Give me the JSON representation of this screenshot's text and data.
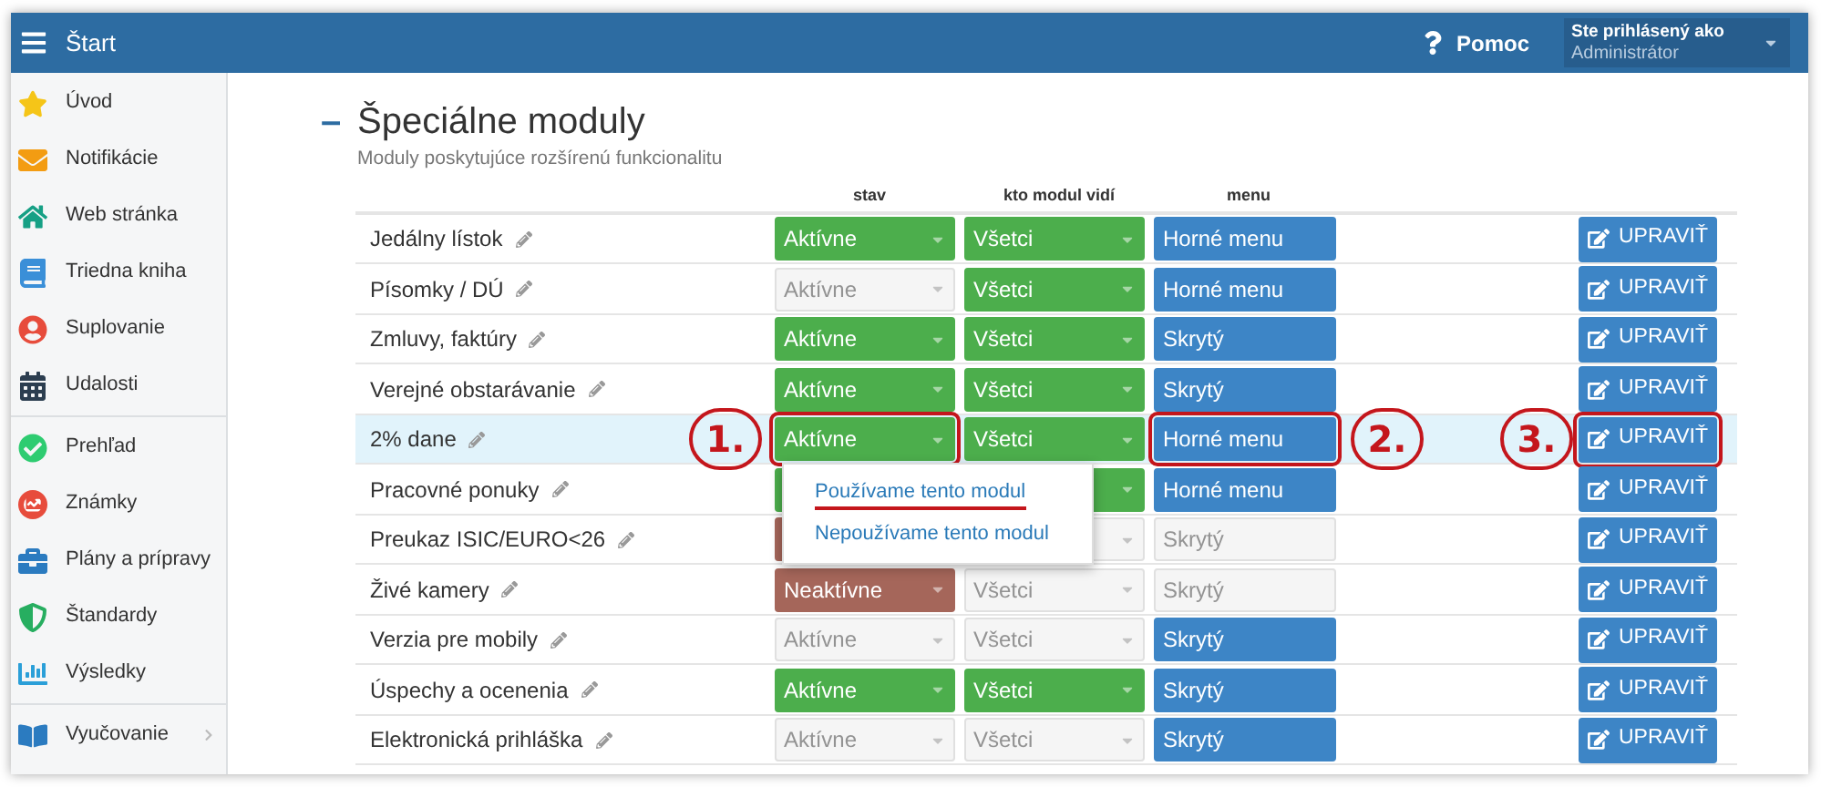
{
  "header": {
    "title": "Štart",
    "help": "Pomoc",
    "user": {
      "label": "Ste prihlásený ako",
      "name": "Administrátor"
    }
  },
  "sidebar": {
    "groups": [
      [
        {
          "label": "Úvod",
          "has_submenu": false
        },
        {
          "label": "Notifikácie",
          "has_submenu": false
        },
        {
          "label": "Web stránka",
          "has_submenu": false
        },
        {
          "label": "Triedna kniha",
          "has_submenu": false
        },
        {
          "label": "Suplovanie",
          "has_submenu": false
        },
        {
          "label": "Udalosti",
          "has_submenu": false
        }
      ],
      [
        {
          "label": "Prehľad",
          "has_submenu": false
        },
        {
          "label": "Známky",
          "has_submenu": false
        },
        {
          "label": "Plány a prípravy",
          "has_submenu": false
        },
        {
          "label": "Štandardy",
          "has_submenu": false
        },
        {
          "label": "Výsledky",
          "has_submenu": false
        }
      ],
      [
        {
          "label": "Vyučovanie",
          "has_submenu": true
        }
      ]
    ]
  },
  "section": {
    "collapse": "–",
    "title": "Špeciálne moduly",
    "subtitle": "Moduly poskytujúce rozšírenú funkcionalitu"
  },
  "table": {
    "columns": [
      "stav",
      "kto modul vidí",
      "menu"
    ],
    "rows": [
      {
        "name": "Jedálny lístok",
        "selected": false,
        "status": {
          "text": "Aktívne",
          "kind": "active"
        },
        "visibility": {
          "text": "Všetci",
          "disabled": false
        },
        "menu": {
          "text": "Horné menu",
          "disabled": false
        },
        "edit": "UPRAVIŤ"
      },
      {
        "name": "Písomky / DÚ",
        "selected": false,
        "status": {
          "text": "Aktívne",
          "kind": "disabled"
        },
        "visibility": {
          "text": "Všetci",
          "disabled": false
        },
        "menu": {
          "text": "Horné menu",
          "disabled": false
        },
        "edit": "UPRAVIŤ"
      },
      {
        "name": "Zmluvy, faktúry",
        "selected": false,
        "status": {
          "text": "Aktívne",
          "kind": "active"
        },
        "visibility": {
          "text": "Všetci",
          "disabled": false
        },
        "menu": {
          "text": "Skrytý",
          "disabled": false
        },
        "edit": "UPRAVIŤ"
      },
      {
        "name": "Verejné obstarávanie",
        "selected": false,
        "status": {
          "text": "Aktívne",
          "kind": "active"
        },
        "visibility": {
          "text": "Všetci",
          "disabled": false
        },
        "menu": {
          "text": "Skrytý",
          "disabled": false
        },
        "edit": "UPRAVIŤ"
      },
      {
        "name": "2% dane",
        "selected": true,
        "status": {
          "text": "Aktívne",
          "kind": "active"
        },
        "visibility": {
          "text": "Všetci",
          "disabled": false
        },
        "menu": {
          "text": "Horné menu",
          "disabled": false
        },
        "edit": "UPRAVIŤ",
        "callouts": {
          "status": "1.",
          "menu": "2.",
          "edit": "3."
        },
        "dropdown": [
          {
            "label": "Používame tento modul",
            "marked": true
          },
          {
            "label": "Nepoužívame tento modul",
            "marked": false
          }
        ]
      },
      {
        "name": "Pracovné ponuky",
        "selected": false,
        "status": {
          "kind": "active"
        },
        "visibility": {
          "disabled": false
        },
        "menu": {
          "text": "Horné menu",
          "disabled": false
        },
        "edit": "UPRAVIŤ"
      },
      {
        "name": "Preukaz ISIC/EURO<26",
        "selected": false,
        "status": {
          "kind": "inactive"
        },
        "visibility": {
          "disabled": true
        },
        "menu": {
          "text": "Skrytý",
          "disabled": true
        },
        "edit": "UPRAVIŤ"
      },
      {
        "name": "Živé kamery",
        "selected": false,
        "status": {
          "text": "Neaktívne",
          "kind": "inactive"
        },
        "visibility": {
          "text": "Všetci",
          "disabled": true
        },
        "menu": {
          "text": "Skrytý",
          "disabled": true
        },
        "edit": "UPRAVIŤ"
      },
      {
        "name": "Verzia pre mobily",
        "selected": false,
        "status": {
          "text": "Aktívne",
          "kind": "disabled"
        },
        "visibility": {
          "text": "Všetci",
          "disabled": true
        },
        "menu": {
          "text": "Skrytý",
          "disabled": false
        },
        "edit": "UPRAVIŤ"
      },
      {
        "name": "Úspechy a ocenenia",
        "selected": false,
        "status": {
          "text": "Aktívne",
          "kind": "active"
        },
        "visibility": {
          "text": "Všetci",
          "disabled": false
        },
        "menu": {
          "text": "Skrytý",
          "disabled": false
        },
        "edit": "UPRAVIŤ"
      },
      {
        "name": "Elektronická prihláška",
        "selected": false,
        "status": {
          "text": "Aktívne",
          "kind": "disabled"
        },
        "visibility": {
          "text": "Všetci",
          "disabled": true
        },
        "menu": {
          "text": "Skrytý",
          "disabled": false
        },
        "edit": "UPRAVIŤ"
      }
    ]
  }
}
